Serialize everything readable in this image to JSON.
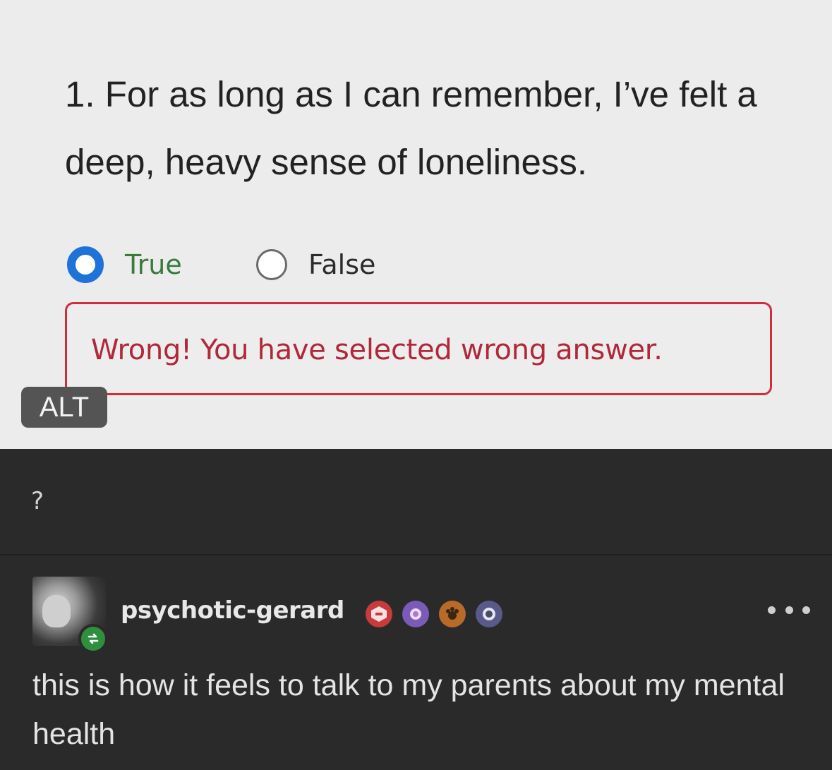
{
  "quiz": {
    "question": "1. For as long as I can remember, I’ve felt a deep, heavy sense of loneliness.",
    "options": [
      {
        "label": "True",
        "selected": true
      },
      {
        "label": "False",
        "selected": false
      }
    ],
    "error_message": "Wrong! You have selected wrong answer.",
    "alt_badge": "ALT"
  },
  "caption": "?",
  "post": {
    "username": "psychotic-gerard",
    "body": "this is how it feels to talk to my parents about my mental health",
    "avatar_icon": "user-avatar",
    "reblog_icon": "reblog-icon",
    "badges": [
      "badge-icon",
      "badge-icon",
      "badge-icon",
      "badge-icon"
    ]
  },
  "colors": {
    "selected_radio": "#1f73d8",
    "error_red": "#cf2e3d",
    "reblog_green": "#2f8f3e",
    "dark_bg": "#2a2a2b",
    "light_bg": "#ececec"
  }
}
